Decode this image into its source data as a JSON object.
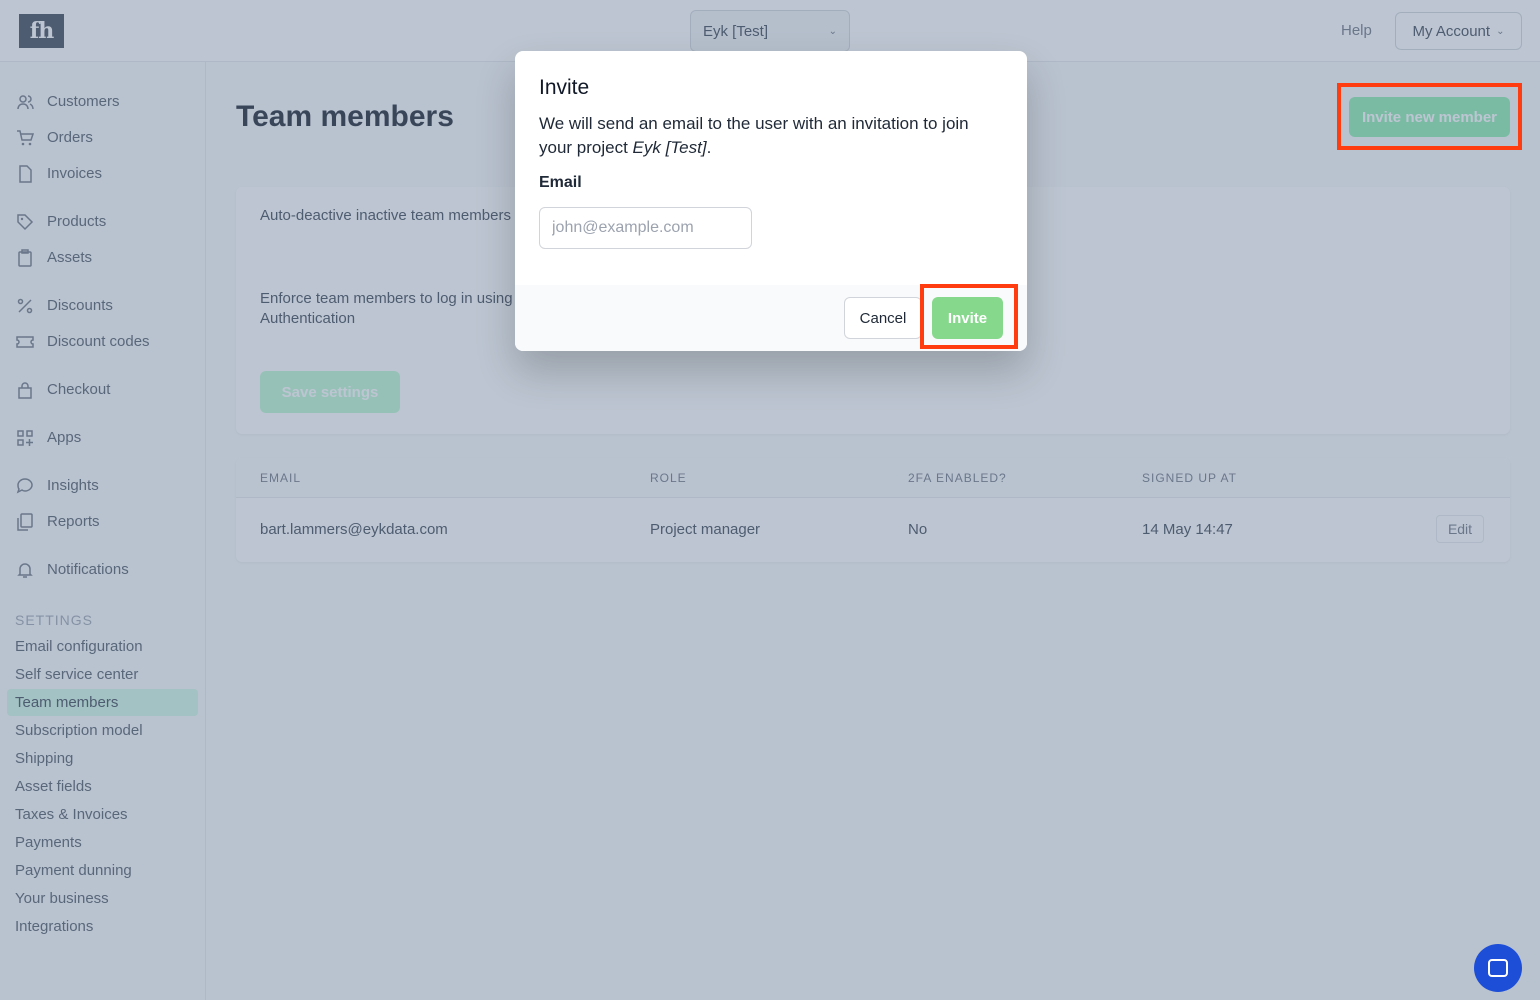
{
  "topbar": {
    "logo_text": "fh",
    "project": "Eyk [Test]",
    "help": "Help",
    "account": "My Account"
  },
  "sidebar": {
    "items": [
      {
        "label": "Customers",
        "icon": "users-icon"
      },
      {
        "label": "Orders",
        "icon": "cart-icon"
      },
      {
        "label": "Invoices",
        "icon": "document-icon"
      },
      {
        "label": "Products",
        "icon": "tag-icon"
      },
      {
        "label": "Assets",
        "icon": "clipboard-icon"
      },
      {
        "label": "Discounts",
        "icon": "percent-icon"
      },
      {
        "label": "Discount codes",
        "icon": "ticket-icon"
      },
      {
        "label": "Checkout",
        "icon": "bag-icon"
      },
      {
        "label": "Apps",
        "icon": "apps-grid-icon"
      },
      {
        "label": "Insights",
        "icon": "chat-icon"
      },
      {
        "label": "Reports",
        "icon": "reports-icon"
      },
      {
        "label": "Notifications",
        "icon": "bell-icon"
      }
    ],
    "settings_heading": "SETTINGS",
    "settings": [
      "Email configuration",
      "Self service center",
      "Team members",
      "Subscription model",
      "Shipping",
      "Asset fields",
      "Taxes & Invoices",
      "Payments",
      "Payment dunning",
      "Your business",
      "Integrations"
    ],
    "active_setting": "Team members"
  },
  "main": {
    "title": "Team members",
    "invite_new": "Invite new member",
    "settings_card": {
      "auto_deactivate": "Auto-deactive inactive team members",
      "enforce_line1": "Enforce team members to log in using",
      "enforce_line2": "Authentication",
      "save": "Save settings"
    },
    "table": {
      "headers": [
        "EMAIL",
        "ROLE",
        "2FA ENABLED?",
        "SIGNED UP AT"
      ],
      "rows": [
        {
          "email": "bart.lammers@eykdata.com",
          "role": "Project manager",
          "twofa": "No",
          "signed_up": "14 May 14:47",
          "action": "Edit"
        }
      ]
    }
  },
  "modal": {
    "title": "Invite",
    "desc_prefix": "We will send an email to the user with an invitation to join your project ",
    "desc_project": "Eyk [Test]",
    "desc_suffix": ".",
    "email_label": "Email",
    "email_placeholder": "john@example.com",
    "email_value": "",
    "cancel": "Cancel",
    "invite": "Invite"
  },
  "colors": {
    "accent_green": "#86d98c",
    "highlight_red": "#ff3b10",
    "chat_blue": "#1d4ed8"
  }
}
